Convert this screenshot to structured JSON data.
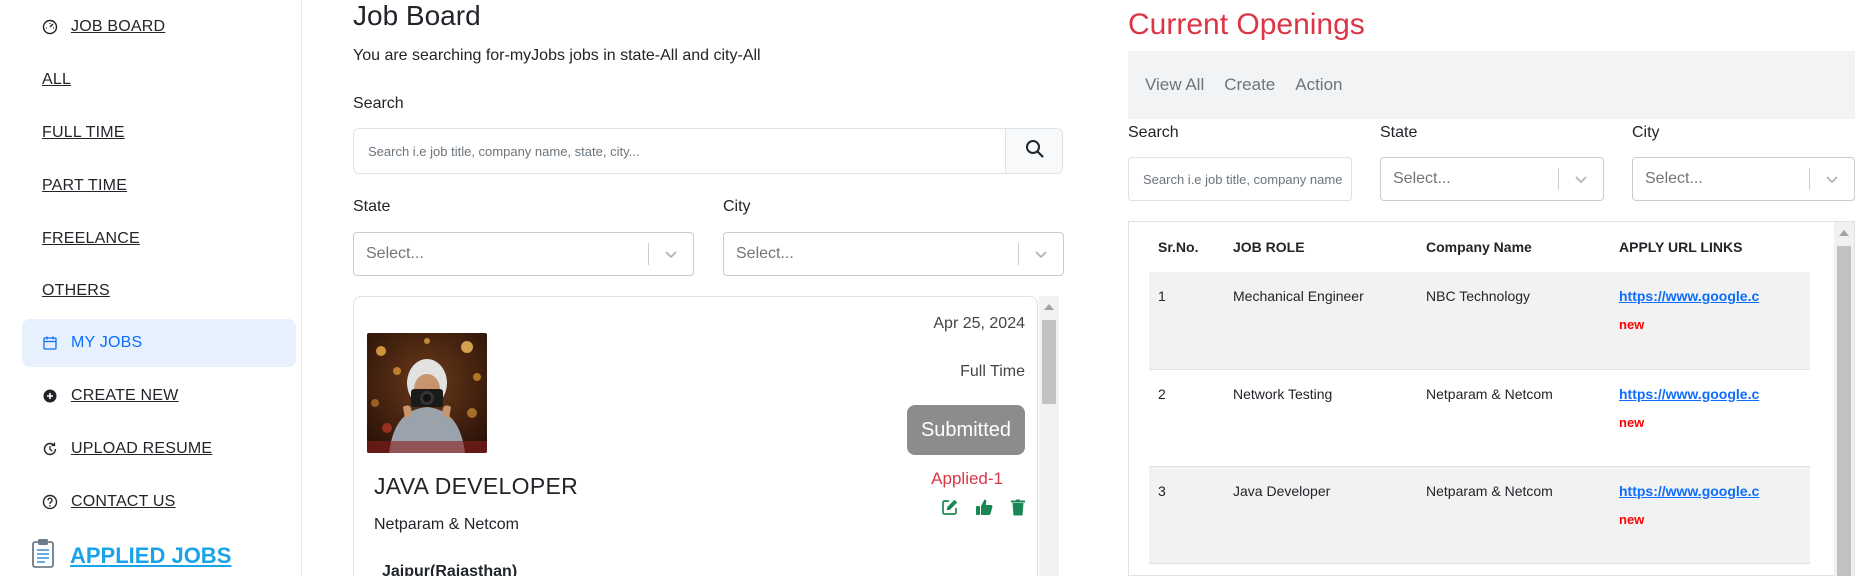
{
  "sidebar": {
    "items": [
      {
        "label": "JOB BOARD",
        "icon": "dashboard-icon",
        "active": false
      },
      {
        "label": "ALL",
        "icon": "",
        "active": false
      },
      {
        "label": "FULL TIME",
        "icon": "",
        "active": false
      },
      {
        "label": "PART TIME",
        "icon": "",
        "active": false
      },
      {
        "label": "FREELANCE",
        "icon": "",
        "active": false
      },
      {
        "label": "OTHERS",
        "icon": "",
        "active": false
      },
      {
        "label": "MY JOBS",
        "icon": "calendar-icon",
        "active": true
      },
      {
        "label": "CREATE NEW",
        "icon": "plus-circle-icon",
        "active": false
      },
      {
        "label": "UPLOAD RESUME",
        "icon": "history-icon",
        "active": false
      },
      {
        "label": "CONTACT US",
        "icon": "question-circle-icon",
        "active": false
      }
    ],
    "applied_jobs": {
      "label": "APPLIED JOBS",
      "icon": "clipboard-icon"
    }
  },
  "board": {
    "title": "Job Board",
    "subtitle": "You are searching for-myJobs jobs in state-All and city-All",
    "search_label": "Search",
    "search_placeholder": "Search i.e job title, company name, state, city...",
    "state_label": "State",
    "state_value": "Select...",
    "city_label": "City",
    "city_value": "Select...",
    "job": {
      "date": "Apr 25, 2024",
      "type": "Full Time",
      "status": "Submitted",
      "applied": "Applied-1",
      "role": "JAVA DEVELOPER",
      "company": "Netparam & Netcom",
      "location": "Jaipur(Rajasthan)"
    }
  },
  "openings": {
    "title": "Current Openings",
    "tabs": [
      "View All",
      "Create",
      "Action"
    ],
    "search_label": "Search",
    "search_placeholder": "Search i.e job title, company name",
    "state_label": "State",
    "state_value": "Select...",
    "city_label": "City",
    "city_value": "Select...",
    "table": {
      "headers": [
        "Sr.No.",
        "JOB ROLE",
        "Company Name",
        "APPLY URL LINKS"
      ],
      "rows": [
        {
          "sr": "1",
          "role": "Mechanical Engineer",
          "company": "NBC Technology",
          "url": "https://www.google.c",
          "badge": "new"
        },
        {
          "sr": "2",
          "role": "Network Testing",
          "company": "Netparam & Netcom",
          "url": "https://www.google.c",
          "badge": "new"
        },
        {
          "sr": "3",
          "role": "Java Developer",
          "company": "Netparam & Netcom",
          "url": "https://www.google.c",
          "badge": "new"
        }
      ]
    }
  },
  "colors": {
    "accent": "#0d6efd",
    "active_bg": "#e6f1fd",
    "openings_title": "#dc3545",
    "applied_link": "#1aa3e8",
    "submitted_bg": "#8c8c8c",
    "action_green": "#198754",
    "new_badge": "#ff0000"
  }
}
